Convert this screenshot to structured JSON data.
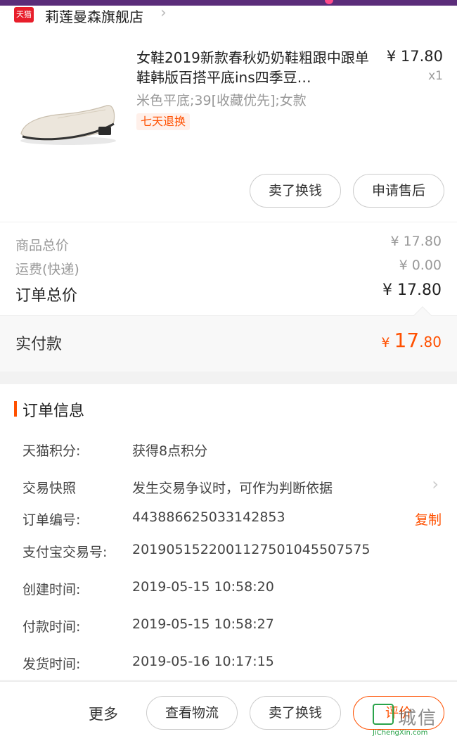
{
  "shop": {
    "badge": "天猫",
    "name": "莉莲曼森旗舰店",
    "chevron": "›"
  },
  "product": {
    "title": "女鞋2019新款春秋奶奶鞋粗跟中跟单鞋韩版百搭平底ins四季豆…",
    "price": "¥ 17.80",
    "qty": "x1",
    "spec": "米色平底;39[收藏优先];女款",
    "return_badge": "七天退换",
    "sell_label": "卖了换钱",
    "after_sale_label": "申请售后"
  },
  "summary": {
    "goods_total_label": "商品总价",
    "goods_total_value": "¥ 17.80",
    "shipping_label": "运费(快递)",
    "shipping_value": "¥ 0.00",
    "order_total_label": "订单总价",
    "order_total_value": "¥ 17.80"
  },
  "paid": {
    "label": "实付款",
    "currency": "¥ ",
    "int": "17",
    "dec": ".80"
  },
  "order_info": {
    "title": "订单信息",
    "rows": [
      {
        "label": "天猫积分:",
        "value": "获得8点积分"
      },
      {
        "label": "交易快照",
        "value": "发生交易争议时，可作为判断依据",
        "chevron": "›"
      },
      {
        "label": "订单编号:",
        "value": "443886625033142853",
        "action": "复制"
      },
      {
        "label": "支付宝交易号:",
        "value": "2019051522001127501045507575"
      },
      {
        "label": "创建时间:",
        "value": "2019-05-15 10:58:20"
      },
      {
        "label": "付款时间:",
        "value": "2019-05-15 10:58:27"
      },
      {
        "label": "发货时间:",
        "value": "2019-05-16 10:17:15"
      }
    ]
  },
  "bottom": {
    "more": "更多",
    "logistics": "查看物流",
    "sell": "卖了换钱",
    "review": "评价"
  },
  "watermark": {
    "text": "城信",
    "sub": "JiChengXin.com"
  },
  "colors": {
    "accent": "#ff5000",
    "tmall_red": "#e81e2b"
  }
}
